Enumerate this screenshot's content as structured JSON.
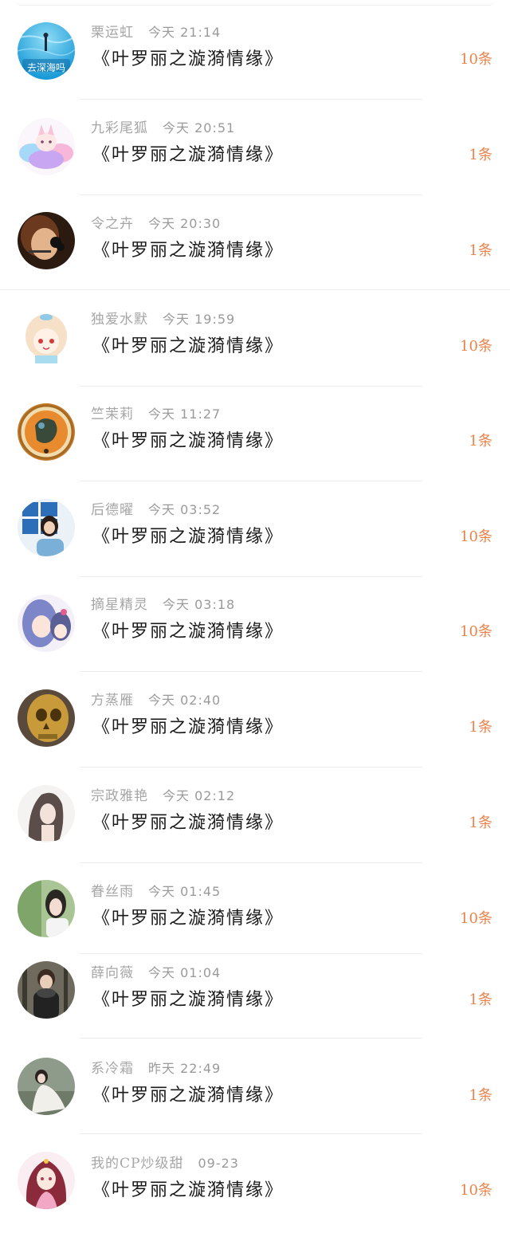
{
  "messages": [
    {
      "name": "栗运虹",
      "time": "今天 21:14",
      "title": "《叶罗丽之漩漪情缘》",
      "count": "10条",
      "avatar_text": "去深海吗",
      "avatar_icon": "ocean-diver-icon"
    },
    {
      "name": "九彩尾狐",
      "time": "今天 20:51",
      "title": "《叶罗丽之漩漪情缘》",
      "count": "1条",
      "avatar_icon": "rainbow-fox-icon"
    },
    {
      "name": "令之卉",
      "time": "今天 20:30",
      "title": "《叶罗丽之漩漪情缘》",
      "count": "1条",
      "avatar_icon": "child-portrait-icon"
    },
    {
      "name": "独爱水默",
      "time": "今天 19:59",
      "title": "《叶罗丽之漩漪情缘》",
      "count": "10条",
      "avatar_icon": "anime-girl-icon"
    },
    {
      "name": "竺茉莉",
      "time": "今天 11:27",
      "title": "《叶罗丽之漩漪情缘》",
      "count": "1条",
      "avatar_icon": "medallion-icon"
    },
    {
      "name": "后德曜",
      "time": "今天 03:52",
      "title": "《叶罗丽之漩漪情缘》",
      "count": "10条",
      "avatar_icon": "girl-window-icon"
    },
    {
      "name": "摘星精灵",
      "time": "今天 03:18",
      "title": "《叶罗丽之漩漪情缘》",
      "count": "10条",
      "avatar_icon": "anime-pair-icon"
    },
    {
      "name": "方蒸雁",
      "time": "今天 02:40",
      "title": "《叶罗丽之漩漪情缘》",
      "count": "1条",
      "avatar_icon": "golden-skull-icon"
    },
    {
      "name": "宗政雅艳",
      "time": "今天 02:12",
      "title": "《叶罗丽之漩漪情缘》",
      "count": "1条",
      "avatar_icon": "sketch-woman-icon"
    },
    {
      "name": "眷丝雨",
      "time": "今天 01:45",
      "title": "《叶罗丽之漩漪情缘》",
      "count": "10条",
      "avatar_icon": "woman-green-icon"
    },
    {
      "name": "薛向薇",
      "time": "今天 01:04",
      "title": "《叶罗丽之漩漪情缘》",
      "count": "1条",
      "avatar_icon": "man-scarf-icon"
    },
    {
      "name": "系冷霜",
      "time": "昨天 22:49",
      "title": "《叶罗丽之漩漪情缘》",
      "count": "1条",
      "avatar_icon": "lady-white-dress-icon"
    },
    {
      "name": "我的CP炒级甜",
      "time": "09-23",
      "title": "《叶罗丽之漩漪情缘》",
      "count": "10条",
      "avatar_icon": "anime-princess-icon"
    }
  ],
  "colors": {
    "count": "#e8844b",
    "title": "#1a1a1a",
    "meta": "#a6a6a6",
    "divider": "#ececec"
  }
}
